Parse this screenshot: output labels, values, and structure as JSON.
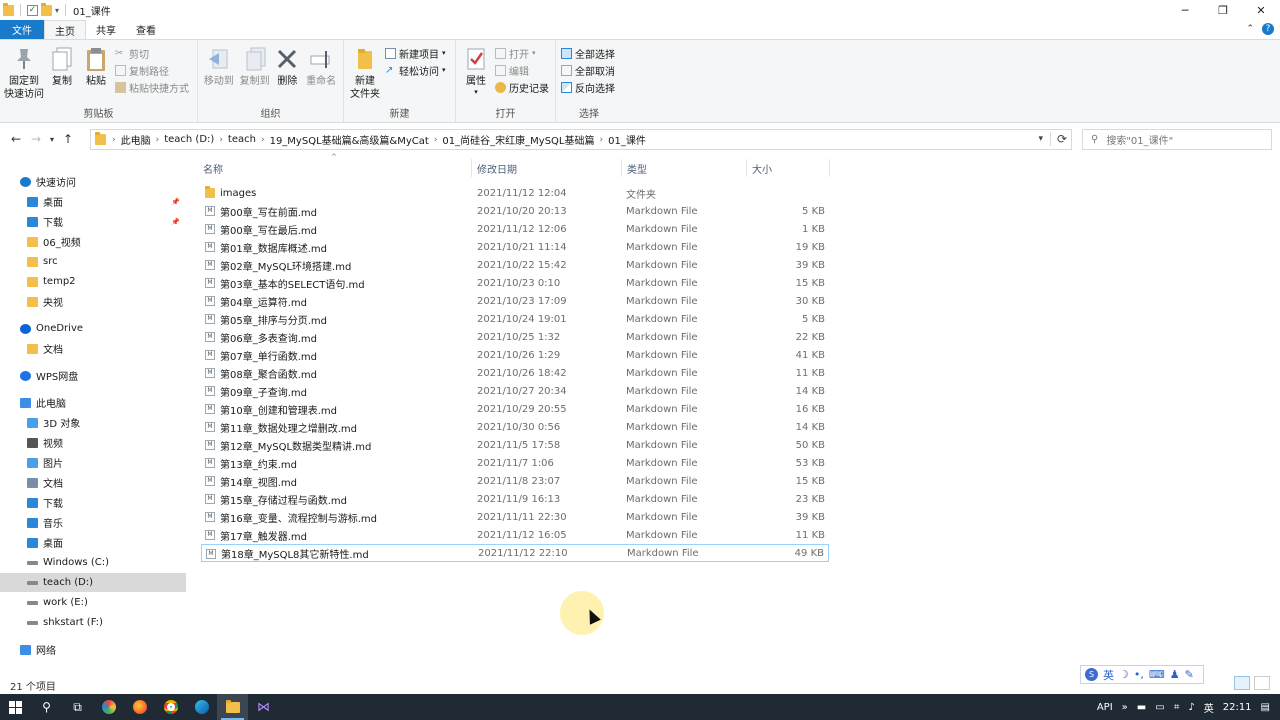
{
  "window": {
    "title": "01_课件"
  },
  "tabs": [
    "文件",
    "主页",
    "共享",
    "查看"
  ],
  "ribbon": {
    "clipboard": {
      "label": "剪贴板",
      "pin": "固定到\n快速访问",
      "copy": "复制",
      "paste": "粘贴",
      "cut": "剪切",
      "copy_path": "复制路径",
      "paste_shortcut": "粘贴快捷方式"
    },
    "organize": {
      "label": "组织",
      "move_to": "移动到",
      "copy_to": "复制到",
      "delete": "删除",
      "rename": "重命名"
    },
    "new": {
      "label": "新建",
      "new_folder": "新建\n文件夹",
      "new_item": "新建项目",
      "easy_access": "轻松访问"
    },
    "open": {
      "label": "打开",
      "properties": "属性",
      "open": "打开",
      "edit": "编辑",
      "history": "历史记录"
    },
    "select": {
      "label": "选择",
      "select_all": "全部选择",
      "select_none": "全部取消",
      "invert": "反向选择"
    }
  },
  "address": {
    "crumbs": [
      "此电脑",
      "teach (D:)",
      "teach",
      "19_MySQL基础篇&高级篇&MyCat",
      "01_尚硅谷_宋红康_MySQL基础篇",
      "01_课件"
    ],
    "search_placeholder": "搜索\"01_课件\""
  },
  "sidebar": {
    "items": [
      {
        "label": "快速访问",
        "icon": "star-icon",
        "color": "#1979ca",
        "indent": 1,
        "pinned": false
      },
      {
        "label": "桌面",
        "icon": "desktop-icon",
        "color": "#2b88d8",
        "indent": 2,
        "pinned": true
      },
      {
        "label": "下载",
        "icon": "download-icon",
        "color": "#2b88d8",
        "indent": 2,
        "pinned": true
      },
      {
        "label": "06_视频",
        "icon": "folder-icon",
        "color": "#f2c04a",
        "indent": 2,
        "pinned": false
      },
      {
        "label": "src",
        "icon": "folder-icon",
        "color": "#f2c04a",
        "indent": 2,
        "pinned": false
      },
      {
        "label": "temp2",
        "icon": "folder-icon",
        "color": "#f2c04a",
        "indent": 2,
        "pinned": false
      },
      {
        "label": "央视",
        "icon": "folder-icon",
        "color": "#f2c04a",
        "indent": 2,
        "pinned": false
      },
      {
        "label": "OneDrive",
        "icon": "cloud-icon",
        "color": "#0a64d6",
        "indent": 1,
        "pinned": false,
        "gap": true
      },
      {
        "label": "文档",
        "icon": "folder-icon",
        "color": "#f2c04a",
        "indent": 2,
        "pinned": false
      },
      {
        "label": "WPS网盘",
        "icon": "cloud-icon",
        "color": "#1e73e8",
        "indent": 1,
        "pinned": false,
        "gap": true
      },
      {
        "label": "此电脑",
        "icon": "computer-icon",
        "color": "#3d8ee6",
        "indent": 1,
        "pinned": false,
        "gap": true
      },
      {
        "label": "3D 对象",
        "icon": "cube-icon",
        "color": "#4aa0e8",
        "indent": 2,
        "pinned": false
      },
      {
        "label": "视频",
        "icon": "video-icon",
        "color": "#555555",
        "indent": 2,
        "pinned": false
      },
      {
        "label": "图片",
        "icon": "picture-icon",
        "color": "#4aa0e8",
        "indent": 2,
        "pinned": false
      },
      {
        "label": "文档",
        "icon": "document-icon",
        "color": "#7a8ea6",
        "indent": 2,
        "pinned": false
      },
      {
        "label": "下载",
        "icon": "download-icon",
        "color": "#2b88d8",
        "indent": 2,
        "pinned": false
      },
      {
        "label": "音乐",
        "icon": "music-icon",
        "color": "#2b88d8",
        "indent": 2,
        "pinned": false
      },
      {
        "label": "桌面",
        "icon": "desktop-icon",
        "color": "#2b88d8",
        "indent": 2,
        "pinned": false
      },
      {
        "label": "Windows (C:)",
        "icon": "drive-icon",
        "color": "#6a7a8a",
        "indent": 2,
        "pinned": false
      },
      {
        "label": "teach (D:)",
        "icon": "drive-icon",
        "color": "#6a7a8a",
        "indent": 2,
        "pinned": false,
        "selected": true
      },
      {
        "label": "work (E:)",
        "icon": "drive-icon",
        "color": "#6a7a8a",
        "indent": 2,
        "pinned": false
      },
      {
        "label": "shkstart (F:)",
        "icon": "drive-icon",
        "color": "#6a7a8a",
        "indent": 2,
        "pinned": false
      },
      {
        "label": "网络",
        "icon": "network-icon",
        "color": "#3d8ee6",
        "indent": 1,
        "pinned": false,
        "gap": true
      }
    ]
  },
  "columns": {
    "name": "名称",
    "date": "修改日期",
    "type": "类型",
    "size": "大小"
  },
  "files": [
    {
      "name": "images",
      "date": "2021/11/12 12:04",
      "type": "文件夹",
      "size": "",
      "kind": "folder"
    },
    {
      "name": "第00章_写在前面.md",
      "date": "2021/10/20 20:13",
      "type": "Markdown File",
      "size": "5 KB",
      "kind": "md"
    },
    {
      "name": "第00章_写在最后.md",
      "date": "2021/11/12 12:06",
      "type": "Markdown File",
      "size": "1 KB",
      "kind": "md"
    },
    {
      "name": "第01章_数据库概述.md",
      "date": "2021/10/21 11:14",
      "type": "Markdown File",
      "size": "19 KB",
      "kind": "md"
    },
    {
      "name": "第02章_MySQL环境搭建.md",
      "date": "2021/10/22 15:42",
      "type": "Markdown File",
      "size": "39 KB",
      "kind": "md"
    },
    {
      "name": "第03章_基本的SELECT语句.md",
      "date": "2021/10/23 0:10",
      "type": "Markdown File",
      "size": "15 KB",
      "kind": "md"
    },
    {
      "name": "第04章_运算符.md",
      "date": "2021/10/23 17:09",
      "type": "Markdown File",
      "size": "30 KB",
      "kind": "md"
    },
    {
      "name": "第05章_排序与分页.md",
      "date": "2021/10/24 19:01",
      "type": "Markdown File",
      "size": "5 KB",
      "kind": "md"
    },
    {
      "name": "第06章_多表查询.md",
      "date": "2021/10/25 1:32",
      "type": "Markdown File",
      "size": "22 KB",
      "kind": "md"
    },
    {
      "name": "第07章_单行函数.md",
      "date": "2021/10/26 1:29",
      "type": "Markdown File",
      "size": "41 KB",
      "kind": "md"
    },
    {
      "name": "第08章_聚合函数.md",
      "date": "2021/10/26 18:42",
      "type": "Markdown File",
      "size": "11 KB",
      "kind": "md"
    },
    {
      "name": "第09章_子查询.md",
      "date": "2021/10/27 20:34",
      "type": "Markdown File",
      "size": "14 KB",
      "kind": "md"
    },
    {
      "name": "第10章_创建和管理表.md",
      "date": "2021/10/29 20:55",
      "type": "Markdown File",
      "size": "16 KB",
      "kind": "md"
    },
    {
      "name": "第11章_数据处理之增删改.md",
      "date": "2021/10/30 0:56",
      "type": "Markdown File",
      "size": "14 KB",
      "kind": "md"
    },
    {
      "name": "第12章_MySQL数据类型精讲.md",
      "date": "2021/11/5 17:58",
      "type": "Markdown File",
      "size": "50 KB",
      "kind": "md"
    },
    {
      "name": "第13章_约束.md",
      "date": "2021/11/7 1:06",
      "type": "Markdown File",
      "size": "53 KB",
      "kind": "md"
    },
    {
      "name": "第14章_视图.md",
      "date": "2021/11/8 23:07",
      "type": "Markdown File",
      "size": "15 KB",
      "kind": "md"
    },
    {
      "name": "第15章_存储过程与函数.md",
      "date": "2021/11/9 16:13",
      "type": "Markdown File",
      "size": "23 KB",
      "kind": "md"
    },
    {
      "name": "第16章_变量、流程控制与游标.md",
      "date": "2021/11/11 22:30",
      "type": "Markdown File",
      "size": "39 KB",
      "kind": "md"
    },
    {
      "name": "第17章_触发器.md",
      "date": "2021/11/12 16:05",
      "type": "Markdown File",
      "size": "11 KB",
      "kind": "md"
    },
    {
      "name": "第18章_MySQL8其它新特性.md",
      "date": "2021/11/12 22:10",
      "type": "Markdown File",
      "size": "49 KB",
      "kind": "md",
      "selected": true
    }
  ],
  "status": {
    "count": "21 个项目"
  },
  "ime": {
    "lang": "英"
  },
  "taskbar": {
    "tray_label": "API",
    "ime_lang": "英",
    "time": "22:11"
  },
  "colors": {
    "accent": "#1979ca",
    "selection_border": "#99d1ff",
    "taskbar": "#1f2a34"
  }
}
